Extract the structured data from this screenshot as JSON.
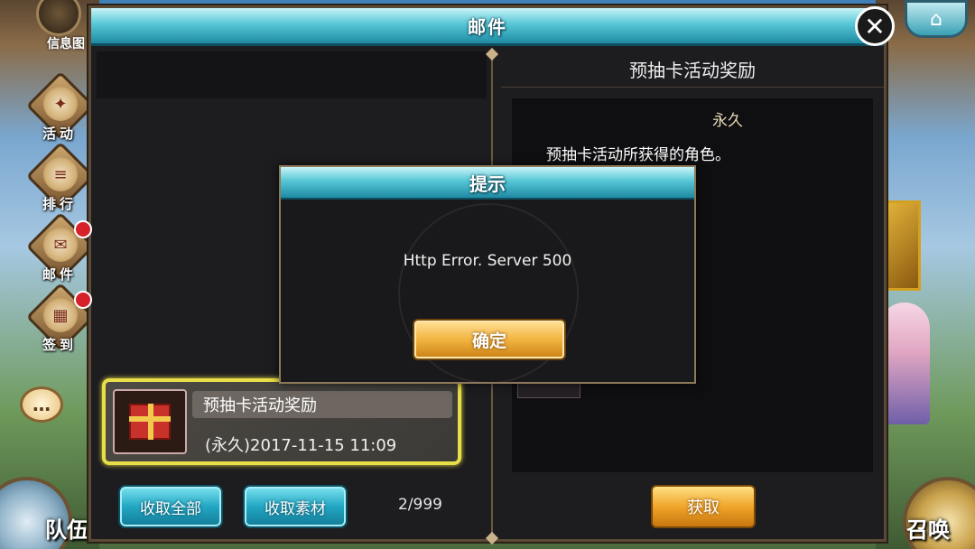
{
  "side_menu": {
    "info_label": "信息图",
    "items": [
      {
        "label": "活动",
        "icon": "lantern-icon",
        "badge": false
      },
      {
        "label": "排行",
        "icon": "ranking-scroll-icon",
        "badge": false
      },
      {
        "label": "邮件",
        "icon": "envelope-icon",
        "badge": true
      },
      {
        "label": "签到",
        "icon": "calendar-icon",
        "badge": true
      }
    ]
  },
  "bottom": {
    "team_label": "队伍",
    "summon_label": "召唤"
  },
  "mail_window": {
    "title": "邮件",
    "list": [
      {
        "title": "预抽卡活动奖励",
        "date": "(永久)2017-11-15  11:09",
        "selected": true
      }
    ],
    "collect_all_label": "收取全部",
    "collect_materials_label": "收取素材",
    "counter": "2/999"
  },
  "detail": {
    "title": "预抽卡活动奖励",
    "duration": "永久",
    "description": "预抽卡活动所获得的角色。",
    "claim_label": "获取"
  },
  "dialog": {
    "title": "提示",
    "message": "Http Error. Server 500",
    "ok_label": "确定"
  },
  "colors": {
    "titlebar_teal": "#56c7d6",
    "selected_border": "#e8de48",
    "gold_button": "#f0a52a",
    "blue_button": "#22a7c4",
    "badge_red": "#d6202a"
  }
}
